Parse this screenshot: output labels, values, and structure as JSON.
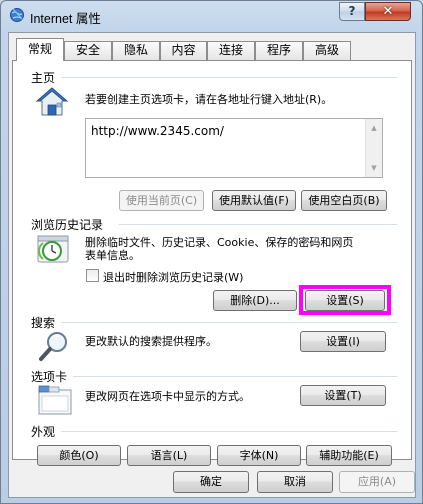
{
  "window": {
    "title": "Internet 属性",
    "help_label": "?",
    "close_label": "✕"
  },
  "tabs": [
    {
      "label": "常规",
      "active": true
    },
    {
      "label": "安全"
    },
    {
      "label": "隐私"
    },
    {
      "label": "内容"
    },
    {
      "label": "连接"
    },
    {
      "label": "程序"
    },
    {
      "label": "高级"
    }
  ],
  "home": {
    "title": "主页",
    "description": "若要创建主页选项卡，请在各地址行键入地址(R)。",
    "url": "http://www.2345.com/",
    "use_current": "使用当前页(C)",
    "use_default": "使用默认值(F)",
    "use_blank": "使用空白页(B)"
  },
  "history": {
    "title": "浏览历史记录",
    "description_line1": "删除临时文件、历史记录、Cookie、保存的密码和网页",
    "description_line2": "表单信息。",
    "checkbox_label": "退出时删除浏览历史记录(W)",
    "delete_button": "删除(D)...",
    "settings_button": "设置(S)"
  },
  "search": {
    "title": "搜索",
    "description": "更改默认的搜索提供程序。",
    "settings_button": "设置(I)"
  },
  "tabs_section": {
    "title": "选项卡",
    "description": "更改网页在选项卡中显示的方式。",
    "settings_button": "设置(T)"
  },
  "appearance": {
    "title": "外观",
    "colors": "颜色(O)",
    "languages": "语言(L)",
    "fonts": "字体(N)",
    "accessibility": "辅助功能(E)"
  },
  "footer": {
    "ok": "确定",
    "cancel": "取消",
    "apply": "应用(A)"
  },
  "colors": {
    "highlight": "#ff00ff"
  }
}
